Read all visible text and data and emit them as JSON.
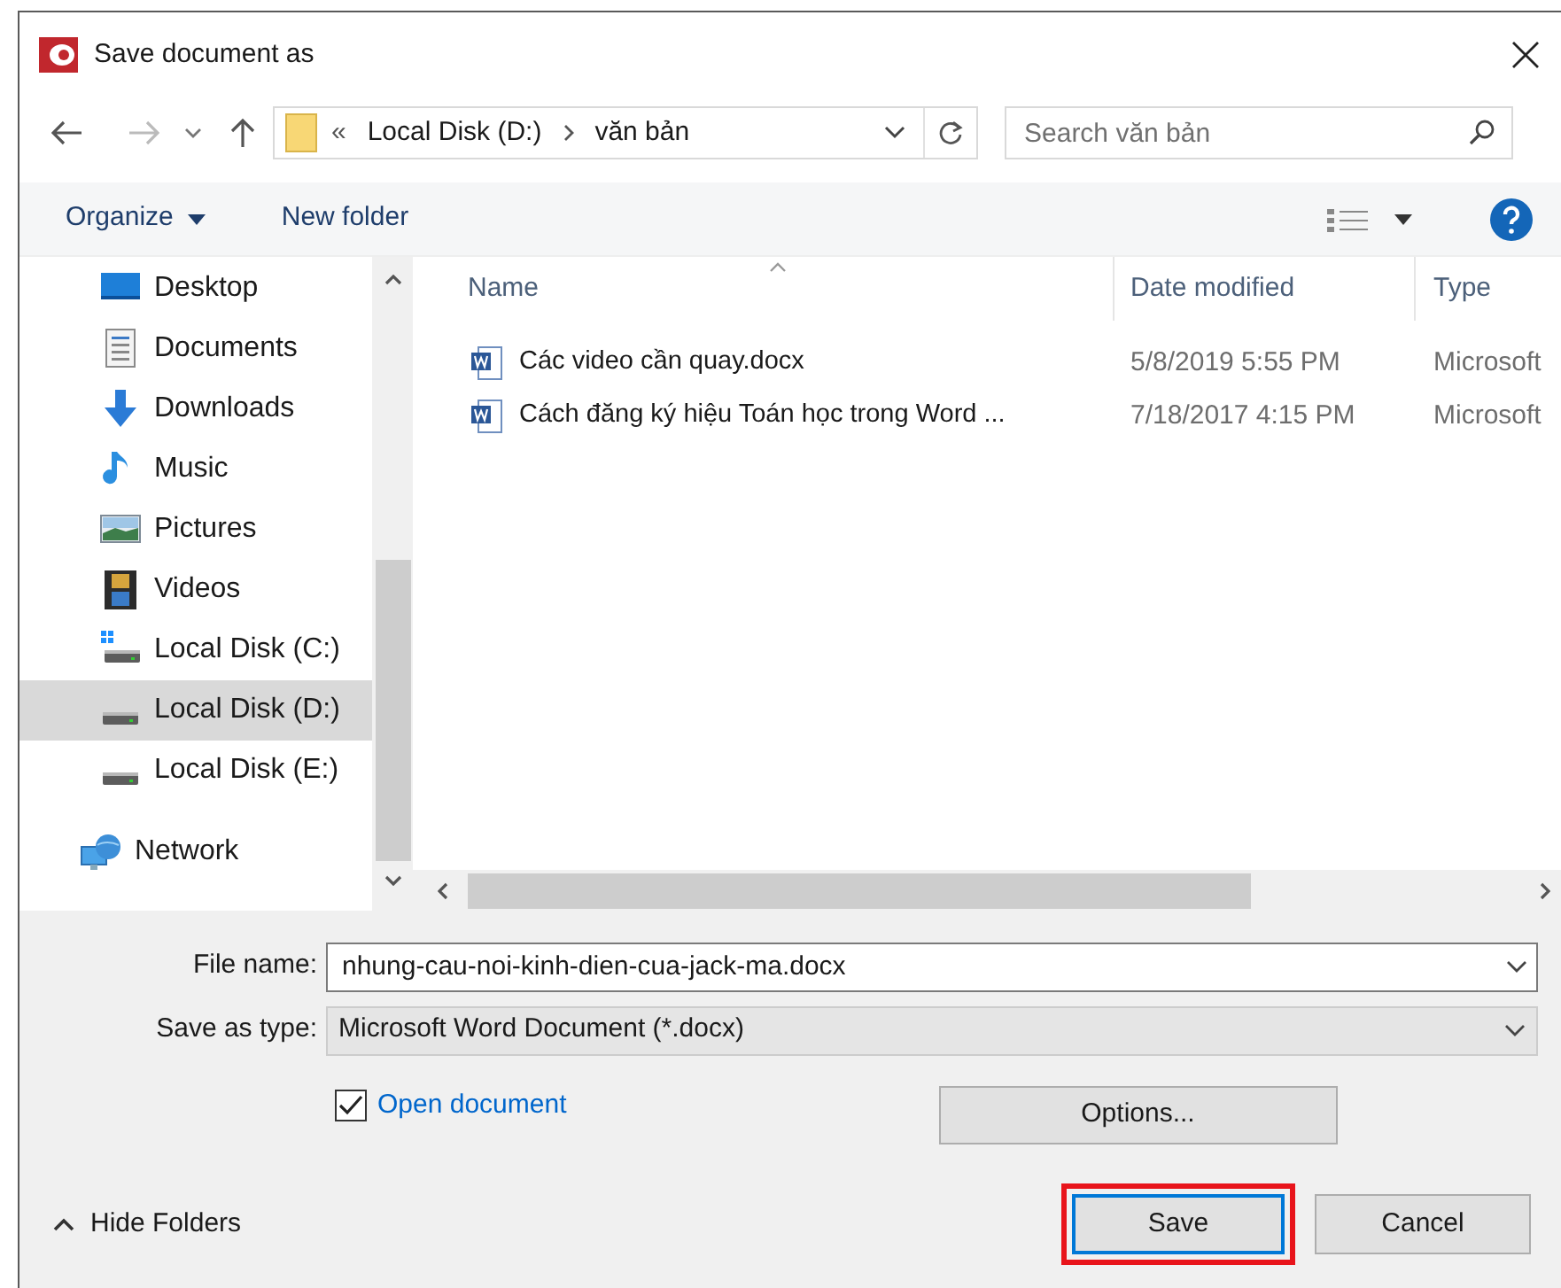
{
  "window": {
    "title": "Save document as"
  },
  "address_bar": {
    "overflow": "«",
    "path": [
      "Local Disk (D:)",
      "văn bản"
    ]
  },
  "search": {
    "placeholder": "Search văn bản"
  },
  "toolbar": {
    "organize": "Organize",
    "new_folder": "New folder"
  },
  "sidebar": {
    "items": [
      {
        "label": "Desktop",
        "kind": "desktop",
        "selected": false
      },
      {
        "label": "Documents",
        "kind": "documents",
        "selected": false
      },
      {
        "label": "Downloads",
        "kind": "downloads",
        "selected": false
      },
      {
        "label": "Music",
        "kind": "music",
        "selected": false
      },
      {
        "label": "Pictures",
        "kind": "pictures",
        "selected": false
      },
      {
        "label": "Videos",
        "kind": "videos",
        "selected": false
      },
      {
        "label": "Local Disk (C:)",
        "kind": "system_disk",
        "selected": false
      },
      {
        "label": "Local Disk (D:)",
        "kind": "disk",
        "selected": true
      },
      {
        "label": "Local Disk (E:)",
        "kind": "disk",
        "selected": false
      },
      {
        "label": "Network",
        "kind": "network",
        "selected": false
      }
    ]
  },
  "file_list": {
    "columns": [
      "Name",
      "Date modified",
      "Type"
    ],
    "rows": [
      {
        "name": "Các video cần quay.docx",
        "date_modified": "5/8/2019 5:55 PM",
        "type": "Microsoft"
      },
      {
        "name": "Cách đăng ký hiệu Toán học trong Word ...",
        "date_modified": "7/18/2017 4:15 PM",
        "type": "Microsoft"
      }
    ]
  },
  "file_name": {
    "label": "File name:",
    "value": "nhung-cau-noi-kinh-dien-cua-jack-ma.docx"
  },
  "save_as_type": {
    "label": "Save as type:",
    "value": "Microsoft Word Document (*.docx)"
  },
  "open_document": {
    "label": "Open document",
    "checked": true
  },
  "buttons": {
    "options": "Options...",
    "save": "Save",
    "cancel": "Cancel"
  },
  "hide_folders": "Hide Folders"
}
